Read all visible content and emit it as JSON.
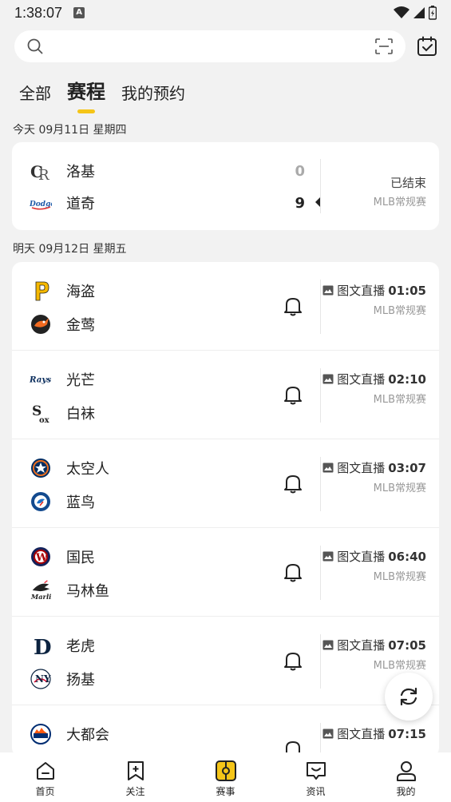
{
  "status_bar": {
    "time": "1:38:07",
    "notif": "A"
  },
  "tabs": [
    {
      "label": "全部"
    },
    {
      "label": "赛程"
    },
    {
      "label": "我的预约"
    }
  ],
  "today": {
    "date_label": "今天 09月11日 星期四",
    "match": {
      "home": "洛基",
      "away": "道奇",
      "home_score": "0",
      "away_score": "9",
      "status": "已结束",
      "league": "MLB常规赛"
    }
  },
  "tomorrow": {
    "date_label": "明天 09月12日 星期五",
    "live_label": "图文直播",
    "league": "MLB常规赛",
    "matches": [
      {
        "team1": "海盗",
        "team2": "金莺",
        "time": "01:05"
      },
      {
        "team1": "光芒",
        "team2": "白袜",
        "time": "02:10"
      },
      {
        "team1": "太空人",
        "team2": "蓝鸟",
        "time": "03:07"
      },
      {
        "team1": "国民",
        "team2": "马林鱼",
        "time": "06:40"
      },
      {
        "team1": "老虎",
        "team2": "扬基",
        "time": "07:05"
      },
      {
        "team1": "大都会",
        "team2": "",
        "time": "07:15"
      }
    ]
  },
  "bottom_nav": [
    {
      "label": "首页"
    },
    {
      "label": "关注"
    },
    {
      "label": "赛事"
    },
    {
      "label": "资讯"
    },
    {
      "label": "我的"
    }
  ],
  "colors": {
    "accent": "#f5c518"
  }
}
